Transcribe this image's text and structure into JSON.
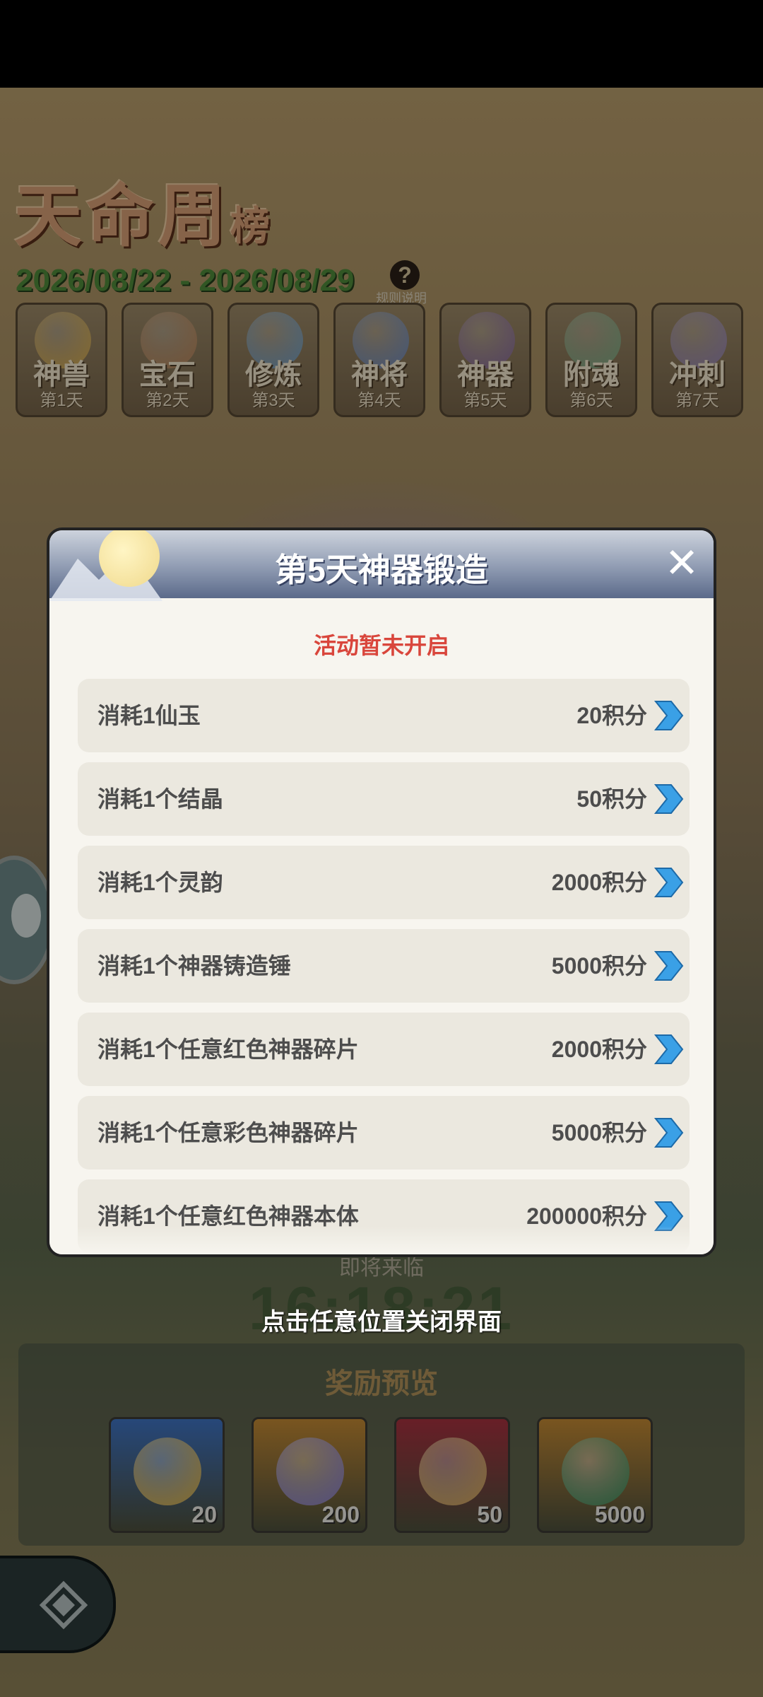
{
  "event": {
    "title_main": "天命周",
    "title_small": "榜",
    "date_range": "2026/08/22 - 2026/08/29",
    "rules_icon": "?",
    "rules_label": "规则说明"
  },
  "day_tabs": [
    {
      "name": "神兽",
      "day": "第1天",
      "art_color": "#e5b64c"
    },
    {
      "name": "宝石",
      "day": "第2天",
      "art_color": "#c48a5a"
    },
    {
      "name": "修炼",
      "day": "第3天",
      "art_color": "#6ea6d8"
    },
    {
      "name": "神将",
      "day": "第4天",
      "art_color": "#6b8fd0"
    },
    {
      "name": "神器",
      "day": "第5天",
      "art_color": "#8a6aa8"
    },
    {
      "name": "附魂",
      "day": "第6天",
      "art_color": "#7cb48a"
    },
    {
      "name": "冲刺",
      "day": "第7天",
      "art_color": "#9a88c4"
    }
  ],
  "modal": {
    "title": "第5天神器锻造",
    "close_icon": "✕",
    "status_message": "活动暂未开启",
    "tasks": [
      {
        "label": "消耗1仙玉",
        "points": "20积分"
      },
      {
        "label": "消耗1个结晶",
        "points": "50积分"
      },
      {
        "label": "消耗1个灵韵",
        "points": "2000积分"
      },
      {
        "label": "消耗1个神器铸造锤",
        "points": "5000积分"
      },
      {
        "label": "消耗1个任意红色神器碎片",
        "points": "2000积分"
      },
      {
        "label": "消耗1个任意彩色神器碎片",
        "points": "5000积分"
      },
      {
        "label": "消耗1个任意红色神器本体",
        "points": "200000积分"
      }
    ]
  },
  "countdown": {
    "coming_label": "即将来临",
    "timer": "16:18:21"
  },
  "close_hint": "点击任意位置关闭界面",
  "rewards": {
    "title": "奖励预览",
    "items": [
      {
        "count": "20",
        "icon": "gem-badge-icon",
        "bg": "#3f74c4",
        "art": "#d9b24a"
      },
      {
        "count": "200",
        "icon": "coin-icon",
        "bg": "#c48a34",
        "art": "#8a7ec8"
      },
      {
        "count": "50",
        "icon": "scroll-icon",
        "bg": "#a8323f",
        "art": "#d9a85a"
      },
      {
        "count": "5000",
        "icon": "jade-dragon-icon",
        "bg": "#c48a34",
        "art": "#3f8f5a"
      }
    ]
  },
  "colors": {
    "accent_red": "#d9463c",
    "chevron_blue": "#3aa0e6",
    "modal_bg": "#f7f5ef",
    "row_bg": "#ebe8df"
  }
}
